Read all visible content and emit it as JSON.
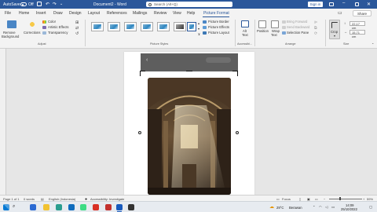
{
  "titlebar": {
    "autosave": "AutoSave",
    "toggle_state": "Off",
    "doc_title": "Document2 - Word",
    "search_placeholder": "Search (Alt+Q)",
    "signin": "Sign in"
  },
  "tabs": [
    "File",
    "Home",
    "Insert",
    "Draw",
    "Design",
    "Layout",
    "References",
    "Mailings",
    "Review",
    "View",
    "Help",
    "Picture Format"
  ],
  "share": "Share",
  "ribbon": {
    "adjust": {
      "remove_bg": [
        "Remove",
        "Background"
      ],
      "corrections": "Corrections",
      "color": "Color",
      "artistic": "Artistic Effects",
      "transparency": "Transparency",
      "label": "Adjust"
    },
    "picture_styles": {
      "label": "Picture Styles",
      "border": "Picture Border",
      "effects": "Picture Effects",
      "layout": "Picture Layout"
    },
    "accessibility": {
      "alt_text": [
        "Alt",
        "Text"
      ],
      "label": "Accessibi..."
    },
    "arrange": {
      "position": "Position",
      "wrap": [
        "Wrap",
        "Text"
      ],
      "bring_forward": "Bring Forward",
      "send_backward": "Send Backward",
      "selection_pane": "Selection Pane",
      "label": "Arrange"
    },
    "size": {
      "crop": "Crop",
      "height": "22,17 cm",
      "width": "15,71 cm",
      "label": "Size"
    }
  },
  "statusbar": {
    "page": "Page 1 of 1",
    "words": "0 words",
    "language": "English (Indonesia)",
    "accessibility": "Accessibility: Investigate",
    "focus": "Focus",
    "zoom": "59%"
  },
  "taskbar": {
    "temperature": "29°C",
    "weather": "Berawan",
    "time": "14:09",
    "date": "25/10/2022"
  },
  "colors": {
    "word_blue": "#2b579a",
    "ribbon_bg": "#f3f3f3"
  }
}
